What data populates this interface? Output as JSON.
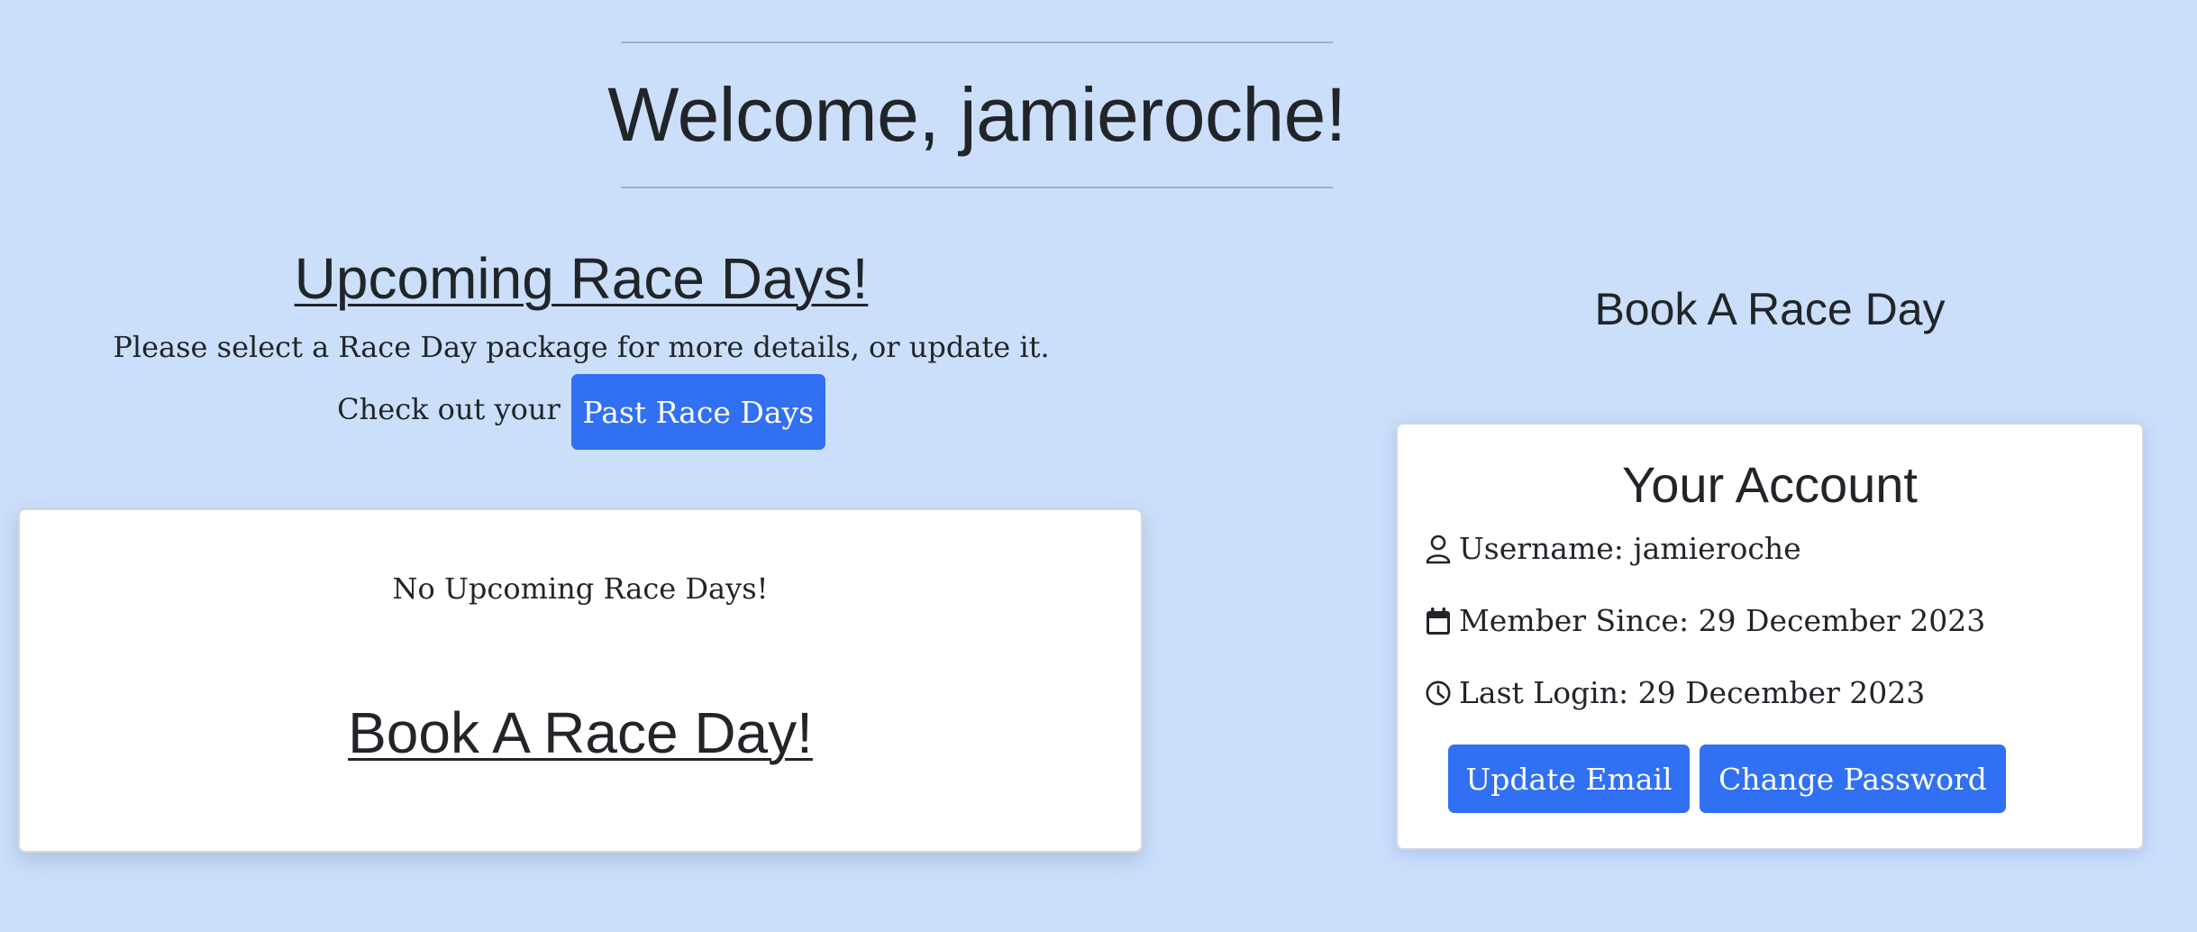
{
  "welcome": {
    "title": "Welcome, jamieroche!"
  },
  "upcoming": {
    "heading": "Upcoming Race Days!",
    "select_text": "Please select a Race Day package for more details, or update it.",
    "check_text": "Check out your",
    "past_button": "Past Race Days",
    "empty_text": "No Upcoming Race Days!",
    "book_link": "Book A Race Day!"
  },
  "book": {
    "heading": "Book A Race Day"
  },
  "account": {
    "title": "Your Account",
    "username": "Username: jamieroche",
    "member_since": "Member Since: 29 December 2023",
    "last_login": "Last Login: 29 December 2023",
    "update_email_button": "Update Email",
    "change_password_button": "Change Password"
  },
  "icons": {
    "user": "person-icon",
    "calendar": "calendar-icon",
    "clock": "clock-icon"
  },
  "colors": {
    "background": "#cbdffa",
    "primary_button": "#3170f3",
    "text": "#212529",
    "card": "#ffffff"
  }
}
